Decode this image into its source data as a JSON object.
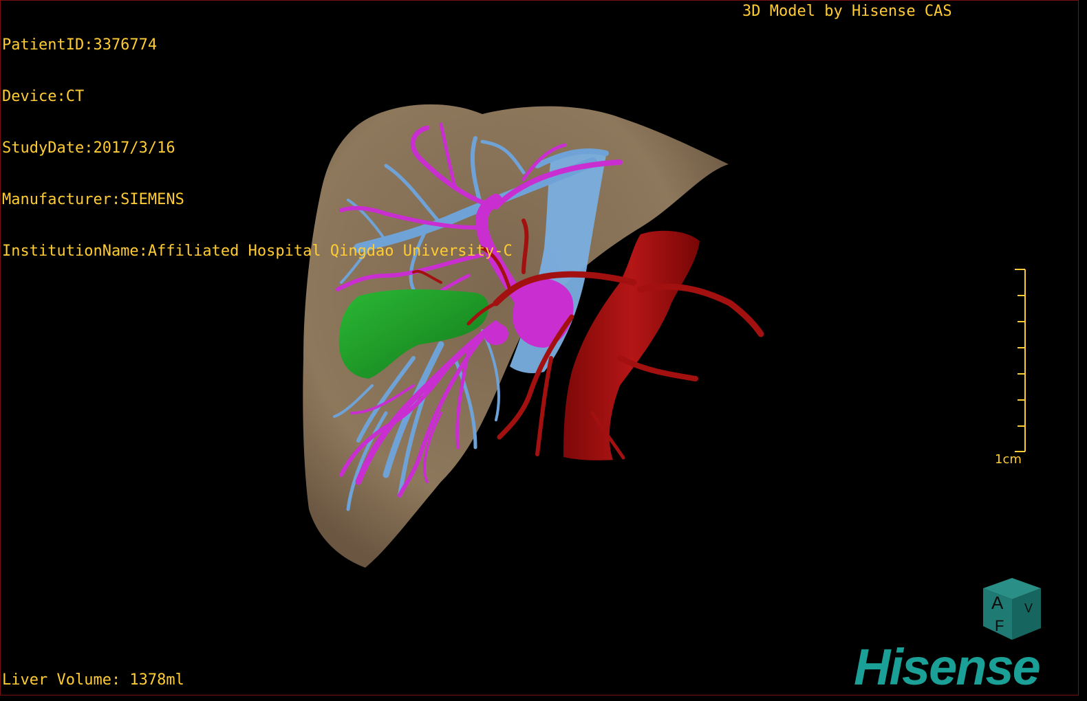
{
  "info": {
    "patient_id": "PatientID:3376774",
    "device": "Device:CT",
    "study_date": "StudyDate:2017/3/16",
    "manufacturer": "Manufacturer:SIEMENS",
    "institution": "InstitutionName:Affiliated Hospital Qingdao University-C"
  },
  "title": "3D Model by Hisense CAS",
  "liver_volume": "Liver Volume: 1378ml",
  "scale": {
    "label": "1cm"
  },
  "orientation_cube": {
    "face_front": "A",
    "face_side": "V",
    "face_bottom": "F"
  },
  "brand": "Hisense",
  "colors": {
    "overlay_text": "#ffcc33",
    "liver": "#8a7358",
    "portal_vein": "#c92fd0",
    "hepatic_vein": "#6fa3d8",
    "artery": "#a31010",
    "gallbladder": "#1e9a28",
    "brand": "#1aa096"
  }
}
